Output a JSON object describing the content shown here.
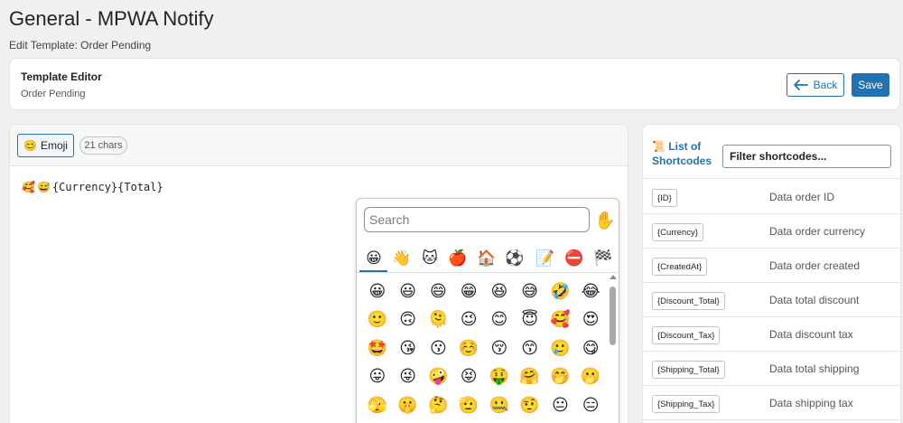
{
  "page": {
    "title": "General - MPWA Notify",
    "subtitle": "Edit Template: Order Pending"
  },
  "header": {
    "title": "Template Editor",
    "subtitle": "Order Pending",
    "back_label": "Back",
    "back_icon": "arrow-left-icon",
    "save_label": "Save"
  },
  "editor": {
    "emoji_button_icon": "😊",
    "emoji_button_label": "Emoji",
    "char_count": "21 chars",
    "content_emojis": [
      "🥰",
      "😅"
    ],
    "content_text": "{Currency}{Total}"
  },
  "emoji_picker": {
    "search_placeholder": "Search",
    "skin_tone": "✋",
    "categories": [
      {
        "name": "smileys",
        "glyph": "😀"
      },
      {
        "name": "people",
        "glyph": "👋"
      },
      {
        "name": "animals",
        "glyph": "🐱"
      },
      {
        "name": "food",
        "glyph": "🍎"
      },
      {
        "name": "travel",
        "glyph": "🏠"
      },
      {
        "name": "activities",
        "glyph": "⚽"
      },
      {
        "name": "objects",
        "glyph": "📝"
      },
      {
        "name": "symbols",
        "glyph": "⛔"
      },
      {
        "name": "flags",
        "glyph": "🏁"
      }
    ],
    "grid": [
      [
        "😀",
        "😃",
        "😄",
        "😁",
        "😆",
        "😅",
        "🤣",
        "😂"
      ],
      [
        "🙂",
        "🙃",
        "🫠",
        "😉",
        "😊",
        "😇",
        "🥰",
        "😍"
      ],
      [
        "🤩",
        "😘",
        "😗",
        "☺️",
        "😚",
        "😙",
        "🥲",
        "😋"
      ],
      [
        "😛",
        "😜",
        "🤪",
        "😝",
        "🤑",
        "🤗",
        "🤭",
        "🫢"
      ],
      [
        "🫣",
        "🤫",
        "🤔",
        "🫡",
        "🤐",
        "🤨",
        "😐",
        "😑"
      ]
    ]
  },
  "shortcodes": {
    "title_icon": "📜",
    "title": "List of Shortcodes",
    "filter_placeholder": "Filter shortcodes...",
    "items": [
      {
        "code": "{ID}",
        "desc": "Data order ID"
      },
      {
        "code": "{Currency}",
        "desc": "Data order currency"
      },
      {
        "code": "{CreatedAt}",
        "desc": "Data order created"
      },
      {
        "code": "{Discount_Total}",
        "desc": "Data total discount"
      },
      {
        "code": "{Discount_Tax}",
        "desc": "Data discount tax"
      },
      {
        "code": "{Shipping_Total}",
        "desc": "Data total shipping"
      },
      {
        "code": "{Shipping_Tax}",
        "desc": "Data shipping tax"
      }
    ]
  },
  "colors": {
    "accent": "#2271b1",
    "background": "#f0f0f1"
  }
}
